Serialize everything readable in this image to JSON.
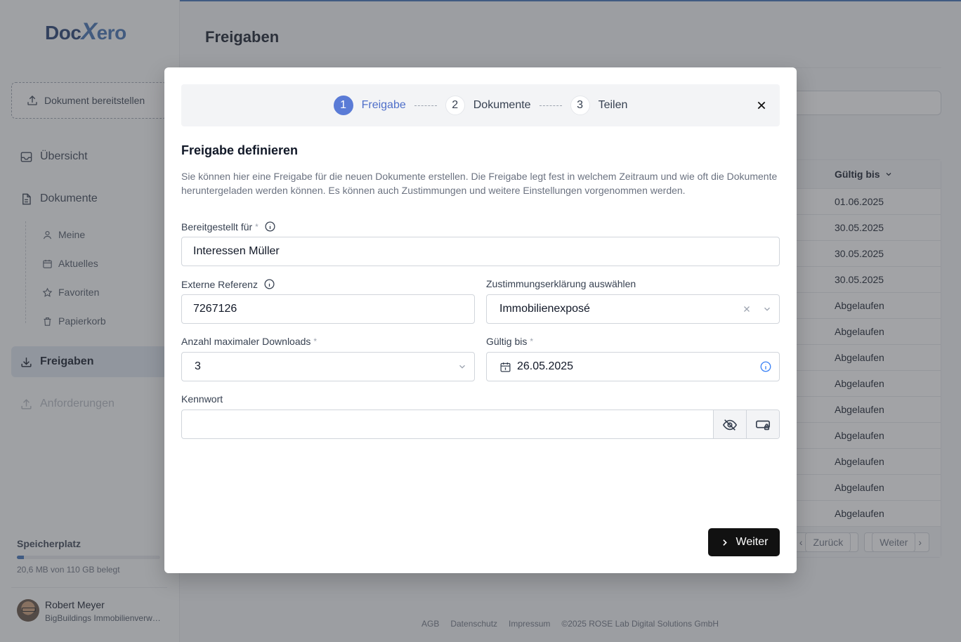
{
  "app": {
    "logo": {
      "part1": "Doc",
      "part2": "X",
      "part3": "ero"
    },
    "upload_label": "Dokument bereitstellen",
    "nav": {
      "overview": "Übersicht",
      "documents": "Dokumente",
      "sub": [
        "Meine",
        "Aktuelles",
        "Favoriten",
        "Papierkorb"
      ],
      "shares": "Freigaben",
      "requests": "Anforderungen"
    },
    "storage": {
      "title": "Speicherplatz",
      "text": "20,6 MB von 110 GB belegt",
      "used_fraction": 0.05
    },
    "user": {
      "name": "Robert Meyer",
      "company": "BigBuildings Immobilienverwaltung"
    },
    "page_title": "Freigaben",
    "table": {
      "header": "Gültig bis",
      "rows": [
        "01.06.2025",
        "30.05.2025",
        "30.05.2025",
        "30.05.2025",
        "Abgelaufen",
        "Abgelaufen",
        "Abgelaufen",
        "Abgelaufen",
        "Abgelaufen",
        "Abgelaufen",
        "Abgelaufen",
        "Abgelaufen",
        "Abgelaufen"
      ],
      "prev": "Zurück",
      "next": "Weiter"
    },
    "footer": [
      "AGB",
      "Datenschutz",
      "Impressum",
      "©2025 ROSE Lab Digital Solutions GmbH"
    ]
  },
  "modal": {
    "steps": [
      {
        "num": "1",
        "label": "Freigabe"
      },
      {
        "num": "2",
        "label": "Dokumente"
      },
      {
        "num": "3",
        "label": "Teilen"
      }
    ],
    "title": "Freigabe definieren",
    "description": "Sie können hier eine Freigabe für die neuen Dokumente erstellen. Die Freigabe legt fest in welchem Zeitraum und wie oft die Dokumente heruntergeladen werden können. Es können auch Zustimmungen und weitere Einstellungen vorgenommen werden.",
    "fields": {
      "recipient": {
        "label": "Bereitgestellt für",
        "value": "Interessen Müller"
      },
      "reference": {
        "label": "Externe Referenz",
        "value": "7267126"
      },
      "consent": {
        "label": "Zustimmungserklärung auswählen",
        "value": "Immobilienexposé"
      },
      "max_downloads": {
        "label": "Anzahl maximaler Downloads",
        "value": "3"
      },
      "valid_until": {
        "label": "Gültig bis",
        "value": "26.05.2025"
      },
      "password": {
        "label": "Kennwort",
        "value": ""
      }
    },
    "required_mark": "*",
    "next_button": "Weiter"
  },
  "colors": {
    "accent": "#5a7bd6",
    "brand": "#3f6fb0",
    "dark_button": "#111111"
  }
}
